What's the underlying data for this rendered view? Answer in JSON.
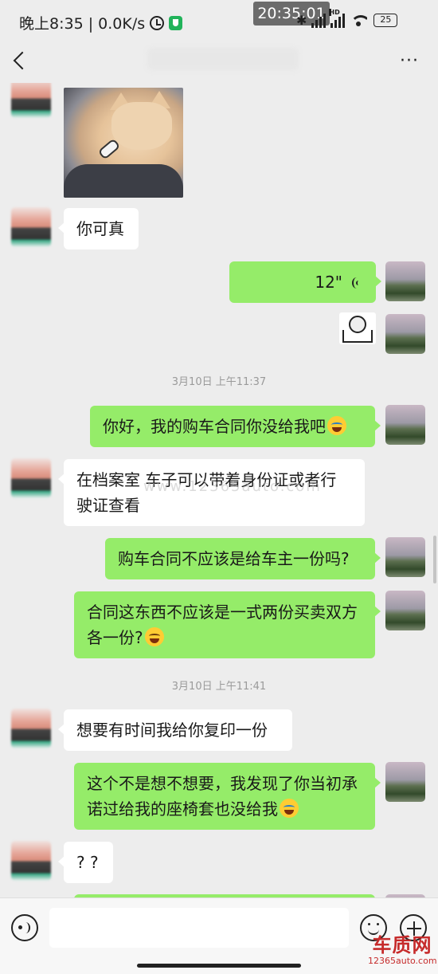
{
  "status_bar": {
    "left_text": "晚上8:35 | 0.0K/s",
    "time_overlay": "20:35:01",
    "signal_label": "HD",
    "battery": "25"
  },
  "nav": {
    "back_icon": "back-arrow-icon",
    "more_label": "···"
  },
  "chat": {
    "timestamps": [
      "3月10日 上午11:37",
      "3月10日 上午11:41"
    ],
    "messages": [
      {
        "side": "left",
        "type": "image",
        "desc": "cat-image"
      },
      {
        "side": "left",
        "type": "text",
        "text": "你可真"
      },
      {
        "side": "right",
        "type": "voice",
        "duration": "12\""
      },
      {
        "side": "right",
        "type": "sticker"
      },
      {
        "side": "right",
        "type": "text",
        "text": "你好，我的购车合同你没给我吧"
      },
      {
        "side": "left",
        "type": "text",
        "text": "在档案室 车子可以带着身份证或者行驶证查看"
      },
      {
        "side": "right",
        "type": "text",
        "text": "购车合同不应该是给车主一份吗?"
      },
      {
        "side": "right",
        "type": "text",
        "text": "合同这东西不应该是一式两份买卖双方各一份?"
      },
      {
        "side": "left",
        "type": "text",
        "text": "想要有时间我给你复印一份"
      },
      {
        "side": "right",
        "type": "text",
        "text": "这个不是想不想要，我发现了你当初承诺过给我的座椅套也没给我"
      },
      {
        "side": "left",
        "type": "text",
        "text": "? ?"
      }
    ],
    "watermark": "www.12365auto.com"
  },
  "input_bar": {
    "placeholder": ""
  },
  "brand": {
    "logo": "车质网",
    "url": "12365auto.com"
  },
  "colors": {
    "background": "#ededed",
    "bubble_me": "#95ec69",
    "bubble_other": "#ffffff"
  }
}
